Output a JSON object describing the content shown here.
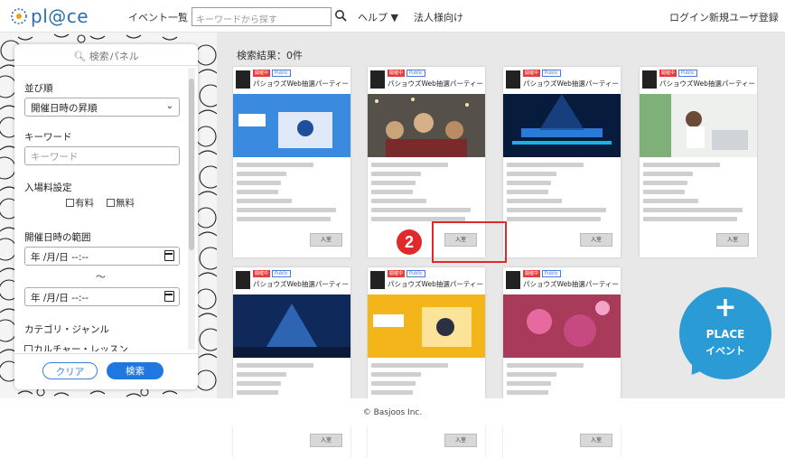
{
  "header": {
    "logo_text": "pl@ce",
    "nav_events": "イベント一覧",
    "search_placeholder": "キーワードから探す",
    "help": "ヘルプ ▼",
    "corporate": "法人様向け",
    "login": "ログイン",
    "register": "新規ユーザ登録"
  },
  "panel": {
    "title": "検索パネル",
    "sort_label": "並び順",
    "sort_value": "開催日時の昇順",
    "keyword_label": "キーワード",
    "keyword_placeholder": "キーワード",
    "fee_label": "入場料設定",
    "fee_paid": "有料",
    "fee_free": "無料",
    "range_label": "開催日時の範囲",
    "date_from": "年 /月/日 --:--",
    "tilde": "～",
    "date_to": "年 /月/日 --:--",
    "category_label": "カテゴリ・ジャンル",
    "category_first": "カルチャー・レッスン",
    "clear": "クリア",
    "search": "検索"
  },
  "results": {
    "title": "検索結果：0件",
    "cards": [
      {
        "tag1": "開催中",
        "tag2": "Public",
        "title": "パショウズWeb抽選パーティー",
        "join": "入室",
        "theme": "blue"
      },
      {
        "tag1": "開催中",
        "tag2": "Public",
        "title": "パショウズWeb抽選パーティー",
        "join": "入室",
        "theme": "party"
      },
      {
        "tag1": "開催中",
        "tag2": "Public",
        "title": "パショウズWeb抽選パーティー",
        "join": "入室",
        "theme": "stage"
      },
      {
        "tag1": "開催中",
        "tag2": "Public",
        "title": "パショウズWeb抽選パーティー",
        "join": "入室",
        "theme": "office"
      },
      {
        "tag1": "開催中",
        "tag2": "Public",
        "title": "パショウズWeb抽選パーティー",
        "join": "入室",
        "theme": "concert"
      },
      {
        "tag1": "開催中",
        "tag2": "Public",
        "title": "パショウズWeb抽選パーティー",
        "join": "入室",
        "theme": "yellow"
      },
      {
        "tag1": "開催中",
        "tag2": "Public",
        "title": "パショウズWeb抽選パーティー",
        "join": "入室",
        "theme": "pink"
      }
    ]
  },
  "annotation": {
    "step": "2",
    "color": "#e02a2a"
  },
  "fab": {
    "plus": "+",
    "line1": "PLACE",
    "line2": "イベント"
  },
  "footer": {
    "copyright": "© Basjoos Inc."
  },
  "colors": {
    "brand": "#2a6fb0",
    "accent": "#1f78e0",
    "fab": "#2a9bd4"
  }
}
